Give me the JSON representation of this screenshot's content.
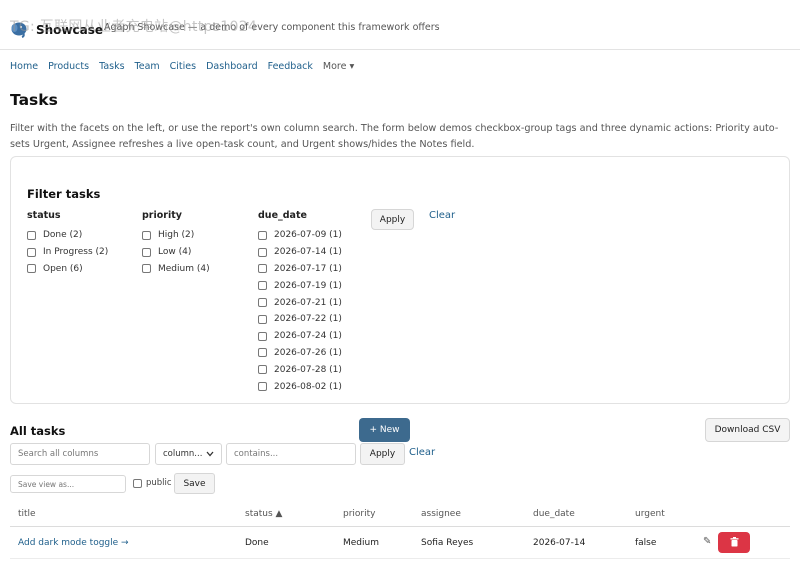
{
  "header": {
    "brand": "Showcase",
    "tagline": "Agaph Showcase — a demo of every component this framework offers",
    "watermark": "TG: 互联网从业者充电站@https1024"
  },
  "nav": {
    "items": [
      "Home",
      "Products",
      "Tasks",
      "Team",
      "Cities",
      "Dashboard",
      "Feedback"
    ],
    "more": "More ▾"
  },
  "page": {
    "title": "Tasks",
    "intro": "Filter with the facets on the left, or use the report's own column search. The form below demos checkbox-group tags and three dynamic actions: Priority auto-sets Urgent, Assignee refreshes a live open-task count, and Urgent shows/hides the Notes field."
  },
  "filters": {
    "title": "Filter tasks",
    "status": {
      "label": "status",
      "options": [
        "Done (2)",
        "In Progress (2)",
        "Open (6)"
      ]
    },
    "priority": {
      "label": "priority",
      "options": [
        "High (2)",
        "Low (4)",
        "Medium (4)"
      ]
    },
    "due_date": {
      "label": "due_date",
      "options": [
        "2026-07-09 (1)",
        "2026-07-14 (1)",
        "2026-07-17 (1)",
        "2026-07-19 (1)",
        "2026-07-21 (1)",
        "2026-07-22 (1)",
        "2026-07-24 (1)",
        "2026-07-26 (1)",
        "2026-07-28 (1)",
        "2026-08-02 (1)"
      ]
    },
    "apply_label": "Apply",
    "clear_label": "Clear"
  },
  "report": {
    "title": "All tasks",
    "new_label": "+ New",
    "csv_label": "Download CSV",
    "search_placeholder": "Search all columns",
    "column_select": "column...",
    "contains_placeholder": "contains...",
    "apply_label": "Apply",
    "clear_label": "Clear",
    "save_view_placeholder": "Save view as...",
    "public_label": "public",
    "save_label": "Save",
    "columns": [
      "title",
      "status ▲",
      "priority",
      "assignee",
      "due_date",
      "urgent"
    ],
    "rows": [
      {
        "title": "Add dark mode toggle →",
        "status": "Done",
        "priority": "Medium",
        "assignee": "Sofia Reyes",
        "due_date": "2026-07-14",
        "urgent": "false"
      }
    ]
  },
  "colors": {
    "primary": "#3d6a8e",
    "link": "#1f5f8b",
    "danger": "#dc3545"
  }
}
